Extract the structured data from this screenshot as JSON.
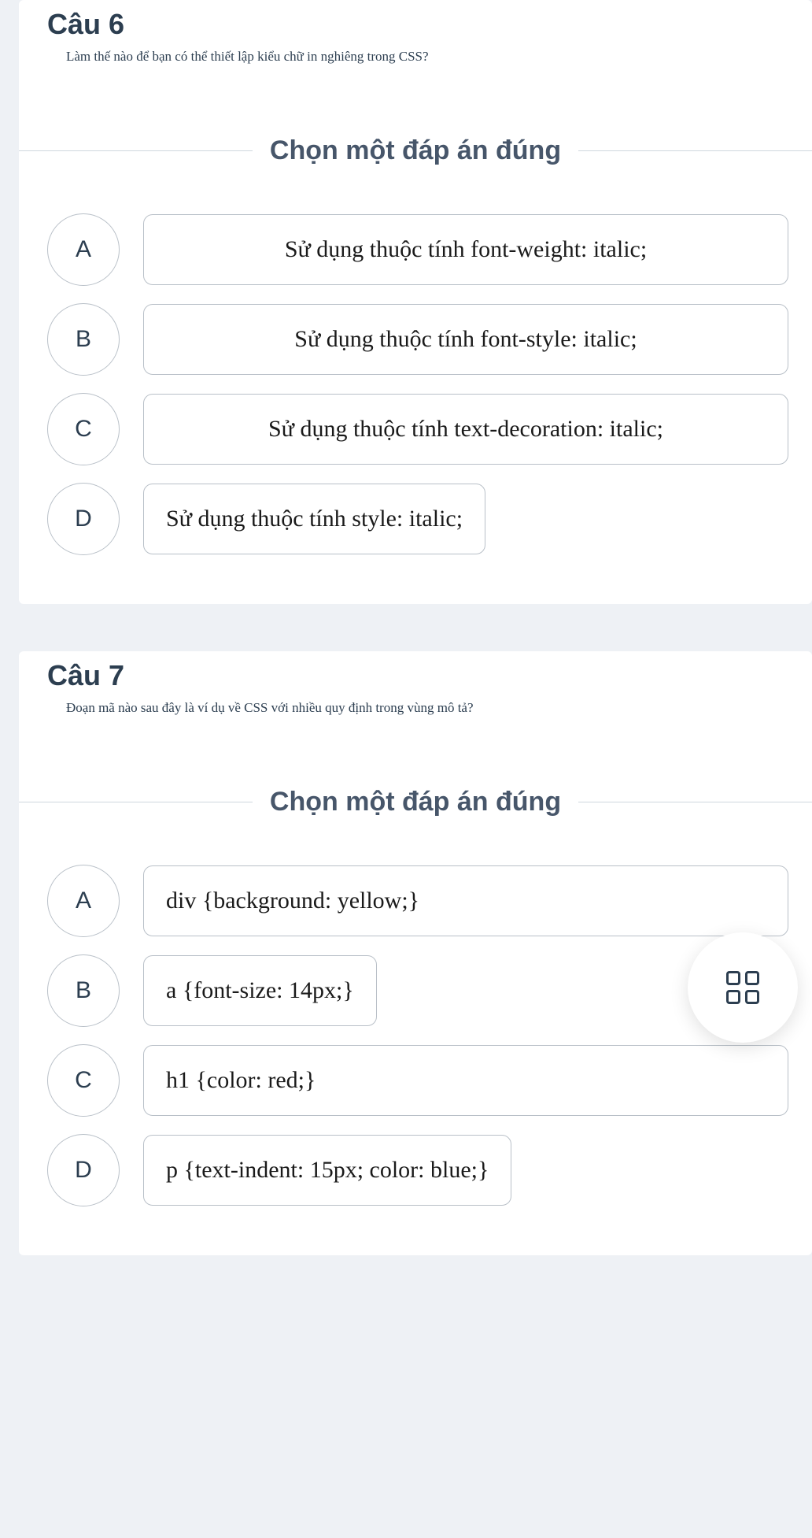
{
  "questions": [
    {
      "title": "Câu 6",
      "text": "Làm thế nào để bạn có thể thiết lập kiểu chữ in nghiêng trong CSS?",
      "instruction": "Chọn một đáp án đúng",
      "options": [
        {
          "letter": "A",
          "text": "Sử dụng thuộc tính font-weight: italic;",
          "width": "full"
        },
        {
          "letter": "B",
          "text": "Sử dụng thuộc tính font-style: italic;",
          "width": "full"
        },
        {
          "letter": "C",
          "text": "Sử dụng thuộc tính text-decoration: italic;",
          "width": "full"
        },
        {
          "letter": "D",
          "text": "Sử dụng thuộc tính style: italic;",
          "width": "fit"
        }
      ]
    },
    {
      "title": "Câu 7",
      "text": "Đoạn mã nào sau đây là ví dụ về CSS với nhiều quy định trong vùng mô tả?",
      "instruction": "Chọn một đáp án đúng",
      "options": [
        {
          "letter": "A",
          "text": "div {background: yellow;}",
          "width": "full"
        },
        {
          "letter": "B",
          "text": "a {font-size: 14px;}",
          "width": "fit"
        },
        {
          "letter": "C",
          "text": "h1 {color: red;}",
          "width": "full"
        },
        {
          "letter": "D",
          "text": "p {text-indent: 15px; color: blue;}",
          "width": "fit"
        }
      ]
    }
  ]
}
